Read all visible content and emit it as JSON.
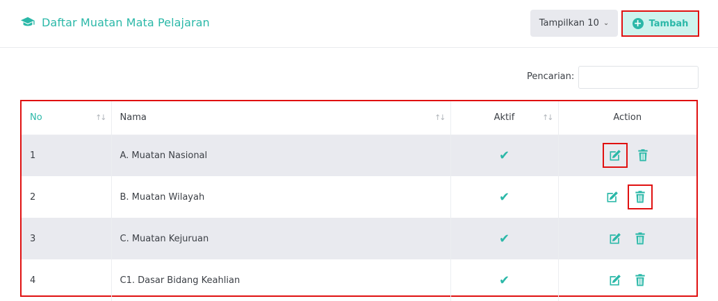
{
  "header": {
    "title": "Daftar Muatan Mata Pelajaran",
    "show_label": "Tampilkan 10",
    "add_label": "Tambah"
  },
  "search": {
    "label": "Pencarian:",
    "value": "",
    "placeholder": ""
  },
  "table": {
    "columns": [
      "No",
      "Nama",
      "Aktif",
      "Action"
    ],
    "rows": [
      {
        "no": "1",
        "nama": "A. Muatan Nasional",
        "aktif": true
      },
      {
        "no": "2",
        "nama": "B. Muatan Wilayah",
        "aktif": true
      },
      {
        "no": "3",
        "nama": "C. Muatan Kejuruan",
        "aktif": true
      },
      {
        "no": "4",
        "nama": "C1. Dasar Bidang Keahlian",
        "aktif": true
      }
    ]
  },
  "colors": {
    "accent": "#2bb8a8",
    "highlight": "#e01010"
  },
  "icons": [
    "graduation-cap-icon",
    "chevron-down-icon",
    "plus-circle-icon",
    "sort-icon",
    "check-icon",
    "edit-icon",
    "trash-icon"
  ]
}
